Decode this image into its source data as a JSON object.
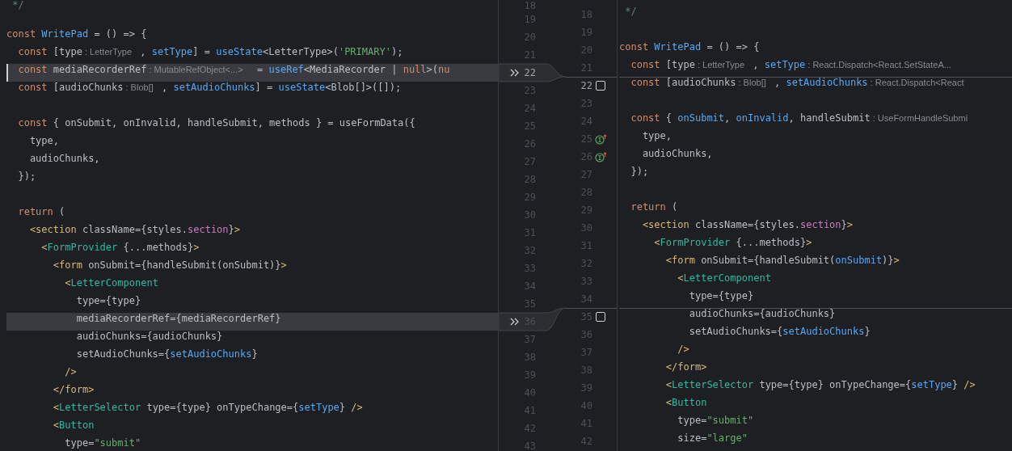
{
  "left_pane": {
    "lines": [
      {
        "number": "18",
        "changed": false,
        "current": false,
        "tokens": [
          {
            "text": " */",
            "kind": "comment"
          }
        ]
      },
      {
        "number": "19",
        "changed": false,
        "current": false
      },
      {
        "number": "20",
        "changed": false,
        "current": false,
        "tokens": [
          {
            "text": "const",
            "kind": "keyword"
          },
          {
            "text": " WritePad",
            "kind": "function"
          },
          {
            "text": " = () => {",
            "kind": "plain"
          }
        ]
      },
      {
        "number": "21",
        "changed": false,
        "current": false,
        "tokens": [
          {
            "text": "  const",
            "kind": "keyword"
          },
          {
            "text": " [type",
            "kind": "plain"
          },
          {
            "text": ": LetterType",
            "kind": "hint"
          },
          {
            "text": " , ",
            "kind": "plain"
          },
          {
            "text": "setType",
            "kind": "function"
          },
          {
            "text": "] = ",
            "kind": "plain"
          },
          {
            "text": "useState",
            "kind": "function"
          },
          {
            "text": "<LetterType>(",
            "kind": "plain"
          },
          {
            "text": "'PRIMARY'",
            "kind": "string"
          },
          {
            "text": ");",
            "kind": "plain"
          }
        ]
      },
      {
        "number": "22",
        "changed": true,
        "current": true,
        "tokens": [
          {
            "text": "  const",
            "kind": "keyword"
          },
          {
            "text": " mediaRecorderRef",
            "kind": "plain"
          },
          {
            "text": ": MutableRefObject<...>",
            "kind": "hint"
          },
          {
            "text": "  = ",
            "kind": "plain"
          },
          {
            "text": "useRef",
            "kind": "function"
          },
          {
            "text": "<MediaRecorder | ",
            "kind": "plain"
          },
          {
            "text": "null",
            "kind": "keyword"
          },
          {
            "text": ">(",
            "kind": "plain"
          },
          {
            "text": "nu",
            "kind": "keyword"
          }
        ]
      },
      {
        "number": "23",
        "changed": false,
        "current": false,
        "tokens": [
          {
            "text": "  const",
            "kind": "keyword"
          },
          {
            "text": " [audioChunks",
            "kind": "plain"
          },
          {
            "text": ": Blob[]",
            "kind": "hint"
          },
          {
            "text": " , ",
            "kind": "plain"
          },
          {
            "text": "setAudioChunks",
            "kind": "function"
          },
          {
            "text": "] = ",
            "kind": "plain"
          },
          {
            "text": "useState",
            "kind": "function"
          },
          {
            "text": "<Blob[]>([]);",
            "kind": "plain"
          }
        ]
      },
      {
        "number": "24",
        "changed": false,
        "current": false
      },
      {
        "number": "25",
        "changed": false,
        "current": false,
        "tokens": [
          {
            "text": "  const",
            "kind": "keyword"
          },
          {
            "text": " { onSubmit, onInvalid, handleSubmit, methods } = useFormData({",
            "kind": "plain"
          }
        ]
      },
      {
        "number": "26",
        "changed": false,
        "current": false,
        "tokens": [
          {
            "text": "    type,",
            "kind": "plain"
          }
        ]
      },
      {
        "number": "27",
        "changed": false,
        "current": false,
        "tokens": [
          {
            "text": "    audioChunks,",
            "kind": "plain"
          }
        ]
      },
      {
        "number": "28",
        "changed": false,
        "current": false,
        "tokens": [
          {
            "text": "  });",
            "kind": "plain"
          }
        ]
      },
      {
        "number": "29",
        "changed": false,
        "current": false
      },
      {
        "number": "30",
        "changed": false,
        "current": false,
        "tokens": [
          {
            "text": "  return",
            "kind": "keyword"
          },
          {
            "text": " (",
            "kind": "plain"
          }
        ]
      },
      {
        "number": "31",
        "changed": false,
        "current": false,
        "tokens": [
          {
            "text": "    <section",
            "kind": "tag"
          },
          {
            "text": " className={styles.",
            "kind": "plain"
          },
          {
            "text": "section",
            "kind": "property"
          },
          {
            "text": "}",
            "kind": "plain"
          },
          {
            "text": ">",
            "kind": "tag"
          }
        ]
      },
      {
        "number": "32",
        "changed": false,
        "current": false,
        "tokens": [
          {
            "text": "      <",
            "kind": "tag"
          },
          {
            "text": "FormProvider",
            "kind": "component"
          },
          {
            "text": " {...methods}",
            "kind": "plain"
          },
          {
            "text": ">",
            "kind": "tag"
          }
        ]
      },
      {
        "number": "33",
        "changed": false,
        "current": false,
        "tokens": [
          {
            "text": "        <form",
            "kind": "tag"
          },
          {
            "text": " onSubmit={handleSubmit(onSubmit)}",
            "kind": "plain"
          },
          {
            "text": ">",
            "kind": "tag"
          }
        ]
      },
      {
        "number": "34",
        "changed": false,
        "current": false,
        "tokens": [
          {
            "text": "          <",
            "kind": "tag"
          },
          {
            "text": "LetterComponent",
            "kind": "component"
          }
        ]
      },
      {
        "number": "35",
        "changed": false,
        "current": false,
        "tokens": [
          {
            "text": "            type={type}",
            "kind": "plain"
          }
        ]
      },
      {
        "number": "36",
        "changed": true,
        "current": false,
        "tokens": [
          {
            "text": "            mediaRecorderRef={mediaRecorderRef}",
            "kind": "plain"
          }
        ]
      },
      {
        "number": "37",
        "changed": false,
        "current": false,
        "tokens": [
          {
            "text": "            audioChunks={audioChunks}",
            "kind": "plain"
          }
        ]
      },
      {
        "number": "38",
        "changed": false,
        "current": false,
        "tokens": [
          {
            "text": "            setAudioChunks={",
            "kind": "plain"
          },
          {
            "text": "setAudioChunks",
            "kind": "function"
          },
          {
            "text": "}",
            "kind": "plain"
          }
        ]
      },
      {
        "number": "39",
        "changed": false,
        "current": false,
        "tokens": [
          {
            "text": "          />",
            "kind": "tag"
          }
        ]
      },
      {
        "number": "40",
        "changed": false,
        "current": false,
        "tokens": [
          {
            "text": "        </form>",
            "kind": "tag"
          }
        ]
      },
      {
        "number": "41",
        "changed": false,
        "current": false,
        "tokens": [
          {
            "text": "        <",
            "kind": "tag"
          },
          {
            "text": "LetterSelector",
            "kind": "component"
          },
          {
            "text": " type={type} onTypeChange={",
            "kind": "plain"
          },
          {
            "text": "setType",
            "kind": "function"
          },
          {
            "text": "} ",
            "kind": "plain"
          },
          {
            "text": "/>",
            "kind": "tag"
          }
        ]
      },
      {
        "number": "42",
        "changed": false,
        "current": false,
        "tokens": [
          {
            "text": "        <",
            "kind": "tag"
          },
          {
            "text": "Button",
            "kind": "component"
          }
        ]
      },
      {
        "number": "43",
        "changed": false,
        "current": false,
        "tokens": [
          {
            "text": "          type=",
            "kind": "plain"
          },
          {
            "text": "\"submit\"",
            "kind": "string"
          }
        ]
      }
    ]
  },
  "right_pane": {
    "lines": [
      {
        "number": "18",
        "change_above": false,
        "current": false,
        "tokens": [
          {
            "text": " */",
            "kind": "comment"
          }
        ]
      },
      {
        "number": "19",
        "change_above": false,
        "current": false
      },
      {
        "number": "20",
        "change_above": false,
        "current": false,
        "tokens": [
          {
            "text": "const",
            "kind": "keyword"
          },
          {
            "text": " WritePad",
            "kind": "function"
          },
          {
            "text": " = () => {",
            "kind": "plain"
          }
        ]
      },
      {
        "number": "21",
        "change_above": false,
        "current": false,
        "tokens": [
          {
            "text": "  const",
            "kind": "keyword"
          },
          {
            "text": " [type",
            "kind": "plain"
          },
          {
            "text": ": LetterType",
            "kind": "hint"
          },
          {
            "text": " , ",
            "kind": "plain"
          },
          {
            "text": "setType",
            "kind": "function"
          },
          {
            "text": ": React.Dispatch<React.SetStateA...",
            "kind": "hint"
          }
        ]
      },
      {
        "number": "22",
        "change_above": true,
        "current": true,
        "gutter_icon": {
          "kind": "checkbox",
          "checked": false
        },
        "tokens": [
          {
            "text": "  const",
            "kind": "keyword"
          },
          {
            "text": " [audioChunks",
            "kind": "plain"
          },
          {
            "text": ": Blob[]",
            "kind": "hint"
          },
          {
            "text": " , ",
            "kind": "plain"
          },
          {
            "text": "setAudioChunks",
            "kind": "function"
          },
          {
            "text": ": React.Dispatch<React",
            "kind": "hint"
          }
        ]
      },
      {
        "number": "23",
        "change_above": false,
        "current": false
      },
      {
        "number": "24",
        "change_above": false,
        "current": false,
        "tokens": [
          {
            "text": "  const",
            "kind": "keyword"
          },
          {
            "text": " { ",
            "kind": "plain"
          },
          {
            "text": "onSubmit",
            "kind": "function"
          },
          {
            "text": ", ",
            "kind": "plain"
          },
          {
            "text": "onInvalid",
            "kind": "function"
          },
          {
            "text": ", handleSubmit",
            "kind": "plain"
          },
          {
            "text": ": UseFormHandleSubmi",
            "kind": "hint"
          }
        ]
      },
      {
        "number": "25",
        "change_above": false,
        "current": false,
        "gutter_icon": {
          "kind": "implements"
        },
        "tokens": [
          {
            "text": "    type,",
            "kind": "plain"
          }
        ]
      },
      {
        "number": "26",
        "change_above": false,
        "current": false,
        "gutter_icon": {
          "kind": "implements"
        },
        "tokens": [
          {
            "text": "    audioChunks,",
            "kind": "plain"
          }
        ]
      },
      {
        "number": "27",
        "change_above": false,
        "current": false,
        "tokens": [
          {
            "text": "  });",
            "kind": "plain"
          }
        ]
      },
      {
        "number": "28",
        "change_above": false,
        "current": false
      },
      {
        "number": "29",
        "change_above": false,
        "current": false,
        "tokens": [
          {
            "text": "  return",
            "kind": "keyword"
          },
          {
            "text": " (",
            "kind": "plain"
          }
        ]
      },
      {
        "number": "30",
        "change_above": false,
        "current": false,
        "tokens": [
          {
            "text": "    <section",
            "kind": "tag"
          },
          {
            "text": " className={styles.",
            "kind": "plain"
          },
          {
            "text": "section",
            "kind": "property"
          },
          {
            "text": "}",
            "kind": "plain"
          },
          {
            "text": ">",
            "kind": "tag"
          }
        ]
      },
      {
        "number": "31",
        "change_above": false,
        "current": false,
        "tokens": [
          {
            "text": "      <",
            "kind": "tag"
          },
          {
            "text": "FormProvider",
            "kind": "component"
          },
          {
            "text": " {...methods}",
            "kind": "plain"
          },
          {
            "text": ">",
            "kind": "tag"
          }
        ]
      },
      {
        "number": "32",
        "change_above": false,
        "current": false,
        "tokens": [
          {
            "text": "        <form",
            "kind": "tag"
          },
          {
            "text": " onSubmit={handleSubmit(",
            "kind": "plain"
          },
          {
            "text": "onSubmit",
            "kind": "function"
          },
          {
            "text": ")}",
            "kind": "plain"
          },
          {
            "text": ">",
            "kind": "tag"
          }
        ]
      },
      {
        "number": "33",
        "change_above": false,
        "current": false,
        "tokens": [
          {
            "text": "          <",
            "kind": "tag"
          },
          {
            "text": "LetterComponent",
            "kind": "component"
          }
        ]
      },
      {
        "number": "34",
        "change_above": false,
        "current": false,
        "tokens": [
          {
            "text": "            type={type}",
            "kind": "plain"
          }
        ]
      },
      {
        "number": "35",
        "change_above": true,
        "current": false,
        "gutter_icon": {
          "kind": "checkbox",
          "checked": false
        },
        "tokens": [
          {
            "text": "            audioChunks={audioChunks}",
            "kind": "plain"
          }
        ]
      },
      {
        "number": "36",
        "change_above": false,
        "current": false,
        "tokens": [
          {
            "text": "            setAudioChunks={",
            "kind": "plain"
          },
          {
            "text": "setAudioChunks",
            "kind": "function"
          },
          {
            "text": "}",
            "kind": "plain"
          }
        ]
      },
      {
        "number": "37",
        "change_above": false,
        "current": false,
        "tokens": [
          {
            "text": "          />",
            "kind": "tag"
          }
        ]
      },
      {
        "number": "38",
        "change_above": false,
        "current": false,
        "tokens": [
          {
            "text": "        </form>",
            "kind": "tag"
          }
        ]
      },
      {
        "number": "39",
        "change_above": false,
        "current": false,
        "tokens": [
          {
            "text": "        <",
            "kind": "tag"
          },
          {
            "text": "LetterSelector",
            "kind": "component"
          },
          {
            "text": " type={type} onTypeChange={",
            "kind": "plain"
          },
          {
            "text": "setType",
            "kind": "function"
          },
          {
            "text": "} ",
            "kind": "plain"
          },
          {
            "text": "/>",
            "kind": "tag"
          }
        ]
      },
      {
        "number": "40",
        "change_above": false,
        "current": false,
        "tokens": [
          {
            "text": "        <",
            "kind": "tag"
          },
          {
            "text": "Button",
            "kind": "component"
          }
        ]
      },
      {
        "number": "41",
        "change_above": false,
        "current": false,
        "tokens": [
          {
            "text": "          type=",
            "kind": "plain"
          },
          {
            "text": "\"submit\"",
            "kind": "string"
          }
        ]
      },
      {
        "number": "42",
        "change_above": false,
        "current": false,
        "tokens": [
          {
            "text": "          size=",
            "kind": "plain"
          },
          {
            "text": "\"large\"",
            "kind": "string"
          }
        ]
      }
    ]
  }
}
